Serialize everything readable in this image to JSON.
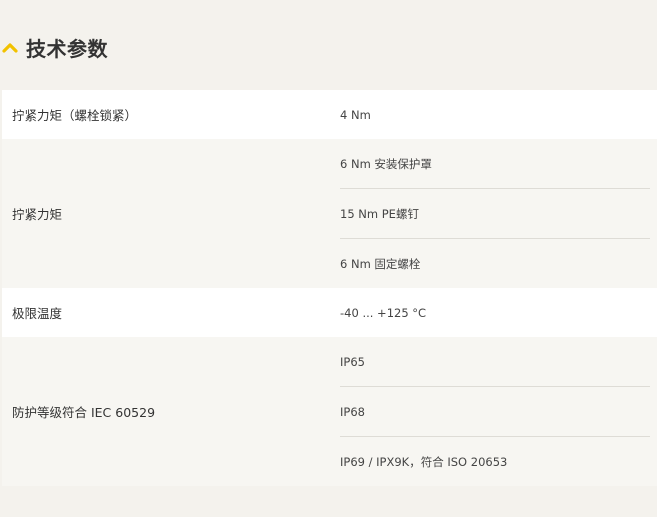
{
  "section": {
    "title": "技术参数",
    "icon": "chevron-up-icon",
    "accent_color": "#f2c200"
  },
  "rows": [
    {
      "label": "拧紧力矩（螺栓锁紧）",
      "values": [
        "4 Nm"
      ]
    },
    {
      "label": "拧紧力矩",
      "values": [
        "6 Nm 安装保护罩",
        "15 Nm PE螺钉",
        "6 Nm 固定螺栓"
      ]
    },
    {
      "label": "极限温度",
      "values": [
        "-40 ... +125 °C"
      ]
    },
    {
      "label": "防护等级符合 IEC 60529",
      "values": [
        "IP65",
        "IP68",
        "IP69 / IPX9K，符合 ISO 20653"
      ]
    }
  ]
}
